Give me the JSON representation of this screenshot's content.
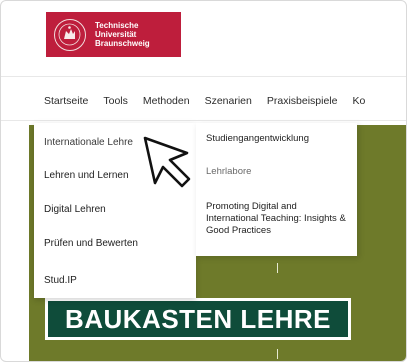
{
  "logo": {
    "line1": "Technische",
    "line2": "Universität",
    "line3": "Braunschweig",
    "bg_color": "#be1e3c"
  },
  "topnav": {
    "items": [
      "Startseite",
      "Tools",
      "Methoden",
      "Szenarien",
      "Praxisbeispiele",
      "Ko"
    ]
  },
  "dropdown": {
    "items": [
      "Internationale Lehre",
      "Lehren und Lernen",
      "Digital Lehren",
      "Prüfen und Bewerten",
      "Stud.IP"
    ]
  },
  "submenu": {
    "items": [
      "Studiengangentwicklung",
      "Lehrlabore",
      "Promoting Digital and International Teaching: Insights & Good Practices"
    ]
  },
  "hero": {
    "banner": "BAUKASTEN LEHRE",
    "bg_color": "#6e7a2a",
    "banner_color": "#0f4c3a"
  },
  "cursor": {
    "icon": "arrow-cursor-icon"
  }
}
